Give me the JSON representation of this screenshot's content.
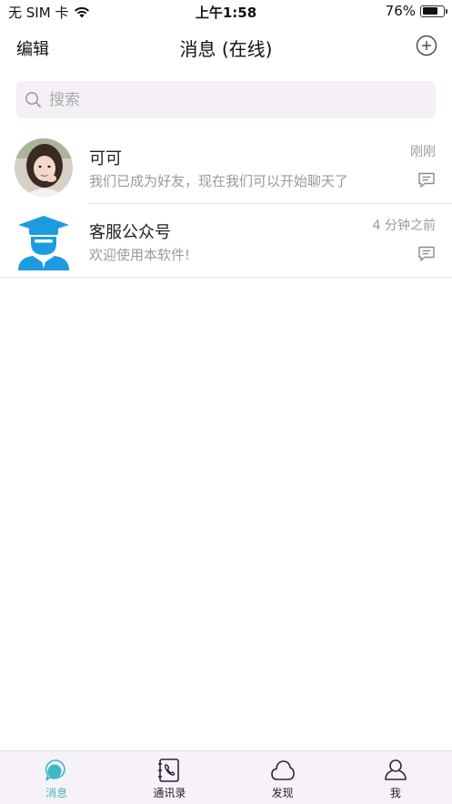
{
  "status_bar": {
    "carrier": "无 SIM 卡",
    "time": "上午1:58",
    "battery_percent": "76%",
    "battery_level": 0.76
  },
  "nav": {
    "edit_label": "编辑",
    "title": "消息 (在线)",
    "add_icon": "plus-circle-icon"
  },
  "search": {
    "placeholder": "搜索",
    "value": ""
  },
  "conversations": [
    {
      "name": "可可",
      "preview": "我们已成为好友，现在我们可以开始聊天了",
      "time": "刚刚",
      "avatar": "photo-avatar"
    },
    {
      "name": "客服公众号",
      "preview": "欢迎使用本软件!",
      "time": "4 分钟之前",
      "avatar": "service-agent-avatar"
    }
  ],
  "tabs": [
    {
      "label": "消息",
      "icon": "message-bubble-icon",
      "active": true
    },
    {
      "label": "通讯录",
      "icon": "contacts-book-icon",
      "active": false
    },
    {
      "label": "发现",
      "icon": "cloud-icon",
      "active": false
    },
    {
      "label": "我",
      "icon": "person-icon",
      "active": false
    }
  ],
  "colors": {
    "accent": "#3db8c2",
    "service_blue": "#1e9be0",
    "search_bg": "#f4f0f5",
    "tabbar_bg": "#f7f2f8",
    "secondary_text": "#9a9a9a"
  }
}
